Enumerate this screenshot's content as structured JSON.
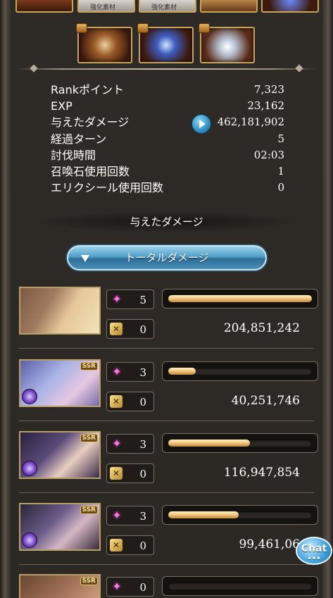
{
  "rewards_top_row": [
    {
      "icon": "item-orb",
      "tag": ""
    },
    {
      "icon": "enhancement-material",
      "tag": "強化素材"
    },
    {
      "icon": "enhancement-material",
      "tag": "強化素材"
    },
    {
      "icon": "item-scroll",
      "tag": ""
    },
    {
      "icon": "item-blue-gem",
      "tag": ""
    }
  ],
  "rewards_chest_row": [
    {
      "icon": "item-gold-orb",
      "chest": "treasure-chest-icon"
    },
    {
      "icon": "item-blue-crystal",
      "chest": "treasure-chest-icon"
    },
    {
      "icon": "item-white-orb",
      "chest": "treasure-chest-icon"
    }
  ],
  "stats": [
    {
      "label": "Rankポイント",
      "value": "7,323"
    },
    {
      "label": "EXP",
      "value": "23,162"
    },
    {
      "label": "与えたダメージ",
      "value": "462,181,902"
    },
    {
      "label": "経過ターン",
      "value": "5"
    },
    {
      "label": "討伐時間",
      "value": "02:03"
    },
    {
      "label": "召喚石使用回数",
      "value": "1"
    },
    {
      "label": "エリクシール使用回数",
      "value": "0"
    }
  ],
  "damage_section": {
    "title": "与えたダメージ",
    "toggle_label": "トータルダメージ"
  },
  "characters": [
    {
      "portrait": "main-character-and-djeeta",
      "rarity": "",
      "skill_count": "5",
      "ca_count": "0",
      "damage_fraction": 1.0,
      "damage": "204,851,242"
    },
    {
      "portrait": "ssr-character-blue-hair",
      "rarity": "SSR",
      "skill_count": "3",
      "ca_count": "0",
      "damage_fraction": 0.19,
      "damage": "40,251,746"
    },
    {
      "portrait": "ssr-character-dark-hair",
      "rarity": "SSR",
      "skill_count": "3",
      "ca_count": "0",
      "damage_fraction": 0.57,
      "damage": "116,947,854"
    },
    {
      "portrait": "ssr-character-horned",
      "rarity": "SSR",
      "skill_count": "3",
      "ca_count": "0",
      "damage_fraction": 0.49,
      "damage": "99,461,06"
    },
    {
      "portrait": "ssr-character-brown-hair",
      "rarity": "SSR",
      "skill_count": "0",
      "ca_count": "",
      "damage_fraction": 0.0,
      "damage": ""
    }
  ],
  "chat_button": {
    "label": "Chat",
    "dots": "•••"
  },
  "colors": {
    "accent_blue": "#4f9ec7",
    "bar_gold": "#f0c27a",
    "frame_gold": "#c8a45a",
    "skill_pink": "#ff7adf"
  }
}
